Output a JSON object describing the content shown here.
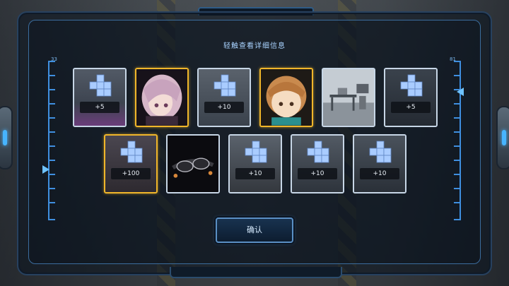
{
  "title": "轻触查看详细信息",
  "ruler_left_num": "33",
  "ruler_right_num": "81",
  "confirm_label": "确认",
  "rows": [
    [
      {
        "kind": "cube",
        "qty": "+5",
        "frame": "white"
      },
      {
        "kind": "portrait-pink-hair",
        "frame": "gold"
      },
      {
        "kind": "cube",
        "qty": "+10",
        "frame": "white"
      },
      {
        "kind": "portrait-brown-hair",
        "frame": "gold"
      },
      {
        "kind": "room-photo",
        "frame": "white"
      },
      {
        "kind": "cube",
        "qty": "+5",
        "frame": "white"
      }
    ],
    [
      {
        "kind": "cube",
        "qty": "+100",
        "frame": "gold"
      },
      {
        "kind": "goggles",
        "frame": "white"
      },
      {
        "kind": "cube",
        "qty": "+10",
        "frame": "white"
      },
      {
        "kind": "cube",
        "qty": "+10",
        "frame": "white"
      },
      {
        "kind": "cube",
        "qty": "+10",
        "frame": "white"
      }
    ]
  ],
  "colors": {
    "accent": "#3f8fe0",
    "gold": "#f0b62a",
    "cube": "#9fc6ff"
  }
}
